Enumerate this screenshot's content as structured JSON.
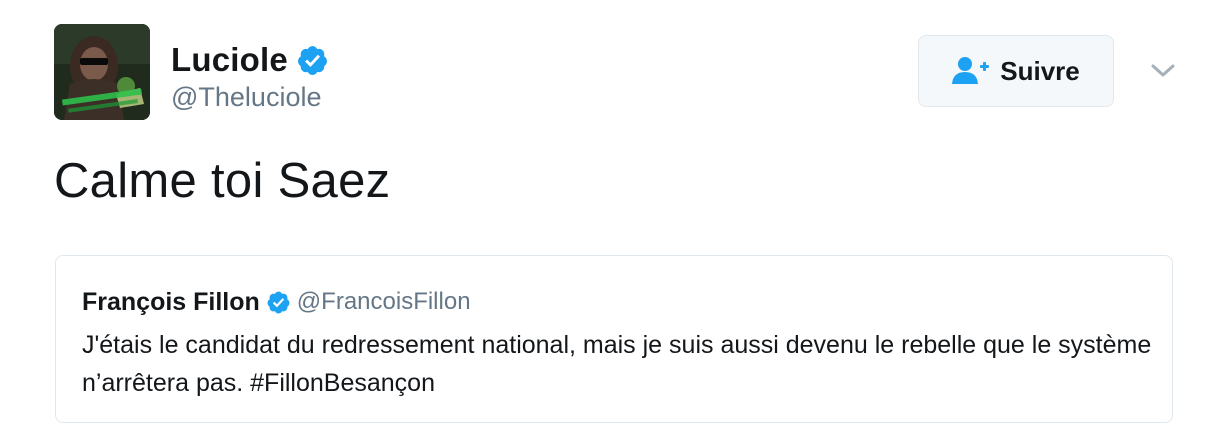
{
  "author": {
    "display_name": "Luciole",
    "handle": "@Theluciole",
    "verified": true,
    "avatar_icon": "user-avatar-image"
  },
  "follow_button": {
    "label": "Suivre",
    "icon": "follow-user-plus-icon"
  },
  "menu_icon": "chevron-down-icon",
  "tweet": {
    "text": "Calme toi Saez"
  },
  "quoted_tweet": {
    "display_name": "François Fillon",
    "handle": "@FrancoisFillon",
    "verified": true,
    "text": "J'étais le candidat du redressement national, mais je suis aussi devenu le rebelle que le système n’arrêtera pas. #FillonBesançon"
  },
  "colors": {
    "verified_blue": "#1da1f2",
    "text_primary": "#14171a",
    "text_secondary": "#657786",
    "border": "#e1e8ed",
    "button_bg": "#f5f8fa"
  }
}
